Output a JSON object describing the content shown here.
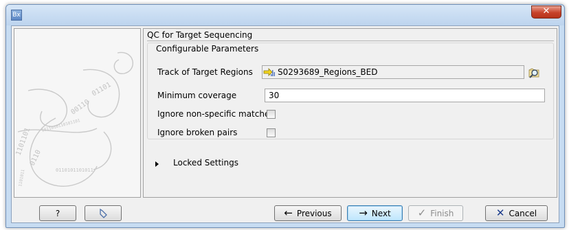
{
  "window": {
    "app_icon": "Bx",
    "close_glyph": "✕"
  },
  "wizard": {
    "panel_title": "QC for Target Sequencing",
    "group_title": "Configurable Parameters",
    "params": {
      "track_label": "Track of Target Regions",
      "track_value": "S0293689_Regions_BED",
      "min_coverage_label": "Minimum coverage",
      "min_coverage_value": "30",
      "ignore_nonspecific_label": "Ignore non-specific matches",
      "ignore_nonspecific_checked": false,
      "ignore_broken_label": "Ignore broken pairs",
      "ignore_broken_checked": false
    },
    "locked_settings_label": "Locked Settings"
  },
  "buttons": {
    "help_label": "?",
    "previous_label": "Previous",
    "next_label": "Next",
    "finish_label": "Finish",
    "cancel_label": "Cancel"
  },
  "icons": {
    "track": "track-arrow-icon",
    "browse": "browse-magnifier-icon",
    "reset": "reset-icon",
    "previous": "arrow-left-icon",
    "next": "arrow-right-icon",
    "finish": "checkmark-icon",
    "cancel": "x-icon"
  },
  "colors": {
    "title_bar": "#bdd4ee",
    "close_button": "#c7432b",
    "dialog_bg": "#f0f0f0",
    "cancel_x": "#1a3c8c"
  }
}
